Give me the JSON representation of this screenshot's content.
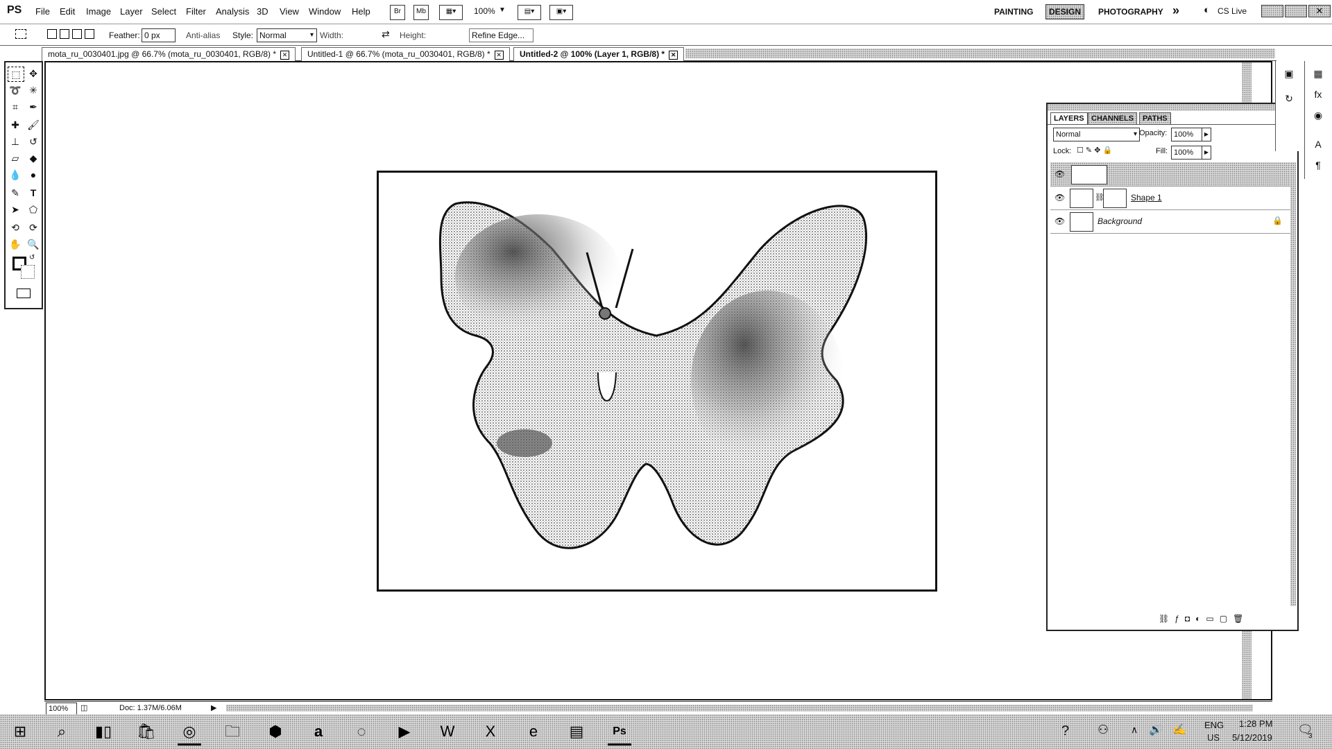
{
  "app": {
    "logo": "PS"
  },
  "menubar": {
    "items": [
      "File",
      "Edit",
      "Image",
      "Layer",
      "Select",
      "Filter",
      "Analysis",
      "3D",
      "View",
      "Window",
      "Help"
    ],
    "quick_buttons": {
      "bridge": "Br",
      "minibridge": "Mb",
      "zoom": "100%"
    },
    "workspaces": {
      "painting": "PAINTING",
      "design": "DESIGN",
      "photography": "PHOTOGRAPHY",
      "more": "»"
    },
    "cslive": "CS Live"
  },
  "options": {
    "feather_label": "Feather:",
    "feather_value": "0 px",
    "antialias": "Anti-alias",
    "style_label": "Style:",
    "style_value": "Normal",
    "width_label": "Width:",
    "height_label": "Height:",
    "refine_edge": "Refine Edge..."
  },
  "tabs": [
    {
      "label": "mota_ru_0030401.jpg @ 66.7% (mota_ru_0030401, RGB/8) *"
    },
    {
      "label": "Untitled-1 @ 66.7% (mota_ru_0030401, RGB/8) *"
    },
    {
      "label": "Untitled-2 @ 100% (Layer 1, RGB/8) *"
    }
  ],
  "layers_panel": {
    "tabs": [
      "LAYERS",
      "CHANNELS",
      "PATHS"
    ],
    "blend_mode": "Normal",
    "opacity_label": "Opacity:",
    "opacity_value": "100%",
    "lock_label": "Lock:",
    "fill_label": "Fill:",
    "fill_value": "100%",
    "layers": [
      {
        "name": "",
        "selected": true
      },
      {
        "name": "Shape 1"
      },
      {
        "name": "Background",
        "locked": true
      }
    ]
  },
  "statusbar": {
    "zoom": "100%",
    "doc": "Doc: 1.37M/6.06M"
  },
  "taskbar": {
    "lang1": "ENG",
    "lang2": "US",
    "time": "1:28 PM",
    "date": "5/12/2019",
    "notifications": "3",
    "icons": [
      "windows-start-icon",
      "search-icon",
      "task-view-icon",
      "store-icon",
      "chrome-icon",
      "file-explorer-icon",
      "dropbox-icon",
      "amazon-icon",
      "app-icon",
      "media-icon",
      "word-icon",
      "excel-icon",
      "edge-icon",
      "notes-icon",
      "photoshop-icon"
    ]
  }
}
